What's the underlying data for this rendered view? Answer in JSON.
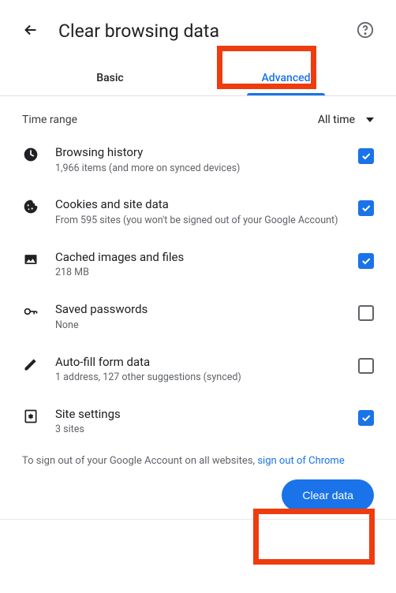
{
  "header": {
    "title": "Clear browsing data"
  },
  "tabs": {
    "basic": "Basic",
    "advanced": "Advanced"
  },
  "time": {
    "label": "Time range",
    "value": "All time"
  },
  "options": [
    {
      "title": "Browsing history",
      "desc": "1,966 items (and more on synced devices)",
      "checked": true
    },
    {
      "title": "Cookies and site data",
      "desc": "From 595 sites (you won't be signed out of your Google Account)",
      "checked": true
    },
    {
      "title": "Cached images and files",
      "desc": "218 MB",
      "checked": true
    },
    {
      "title": "Saved passwords",
      "desc": "None",
      "checked": false
    },
    {
      "title": "Auto-fill form data",
      "desc": "1 address, 127 other suggestions (synced)",
      "checked": false
    },
    {
      "title": "Site settings",
      "desc": "3 sites",
      "checked": true
    }
  ],
  "footer": {
    "text": "To sign out of your Google Account on all websites, ",
    "link": "sign out of Chrome"
  },
  "action": {
    "clear": "Clear data"
  }
}
